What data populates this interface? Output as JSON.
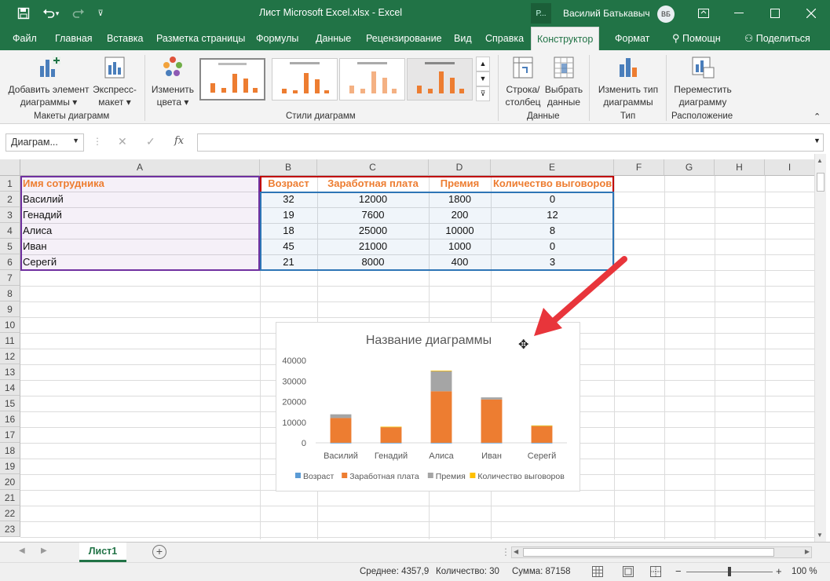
{
  "titlebar": {
    "doc_title": "Лист Microsoft Excel.xlsx  -  Excel",
    "user_box": "Р...",
    "user_name": "Василий Батькавыч",
    "avatar_initials": "ВБ"
  },
  "tabs": [
    "Файл",
    "Главная",
    "Вставка",
    "Разметка страницы",
    "Формулы",
    "Данные",
    "Рецензирование",
    "Вид",
    "Справка",
    "Конструктор",
    "Формат",
    "Помощн",
    "Поделиться"
  ],
  "ribbon": {
    "add_element": "Добавить элемент",
    "add_element2": "диаграммы",
    "quick_layout": "Экспресс-",
    "quick_layout2": "макет",
    "change_colors": "Изменить",
    "change_colors2": "цвета",
    "group_layouts": "Макеты диаграмм",
    "group_styles": "Стили диаграмм",
    "switch_row": "Строка/",
    "switch_row2": "столбец",
    "select_data": "Выбрать",
    "select_data2": "данные",
    "group_data": "Данные",
    "change_type": "Изменить тип",
    "change_type2": "диаграммы",
    "group_type": "Тип",
    "move_chart": "Переместить",
    "move_chart2": "диаграмму",
    "group_location": "Расположение"
  },
  "formula_bar": {
    "name_box": "Диаграм...",
    "fx": "fx",
    "cancel": "✕",
    "enter": "✓",
    "formula": ""
  },
  "grid": {
    "columns": [
      "A",
      "B",
      "C",
      "D",
      "E",
      "F",
      "G",
      "H",
      "I"
    ],
    "rows": [
      "1",
      "2",
      "3",
      "4",
      "5",
      "6",
      "7",
      "8",
      "9",
      "10",
      "11",
      "12",
      "13",
      "14",
      "15",
      "16",
      "17",
      "18",
      "19",
      "20",
      "21",
      "22",
      "23"
    ],
    "headers": [
      "Имя сотрудника",
      "Возраст",
      "Заработная плата",
      "Премия",
      "Количество выговоров"
    ],
    "data": [
      [
        "Василий",
        "32",
        "12000",
        "1800",
        "0"
      ],
      [
        "Генадий",
        "19",
        "7600",
        "200",
        "12"
      ],
      [
        "Алиса",
        "18",
        "25000",
        "10000",
        "8"
      ],
      [
        "Иван",
        "45",
        "21000",
        "1000",
        "0"
      ],
      [
        "Серегй",
        "21",
        "8000",
        "400",
        "3"
      ]
    ]
  },
  "chart_data": {
    "type": "bar",
    "stacked": true,
    "title": "Название диаграммы",
    "categories": [
      "Василий",
      "Генадий",
      "Алиса",
      "Иван",
      "Серегй"
    ],
    "series": [
      {
        "name": "Возраст",
        "values": [
          32,
          19,
          18,
          45,
          21
        ],
        "color": "#5b9bd5"
      },
      {
        "name": "Заработная плата",
        "values": [
          12000,
          7600,
          25000,
          21000,
          8000
        ],
        "color": "#ed7d31"
      },
      {
        "name": "Премия",
        "values": [
          1800,
          200,
          10000,
          1000,
          400
        ],
        "color": "#a5a5a5"
      },
      {
        "name": "Количество выговоров",
        "values": [
          0,
          12,
          8,
          0,
          3
        ],
        "color": "#ffc000"
      }
    ],
    "y_ticks": [
      "0",
      "10000",
      "20000",
      "30000",
      "40000"
    ],
    "ylim": [
      0,
      40000
    ],
    "legend": "bottom",
    "grid": false
  },
  "sheet_tabs": {
    "active": "Лист1",
    "add": "+"
  },
  "status": {
    "average": "Среднее: 4357,9",
    "count": "Количество: 30",
    "sum": "Сумма: 87158",
    "zoom": "100 %"
  }
}
